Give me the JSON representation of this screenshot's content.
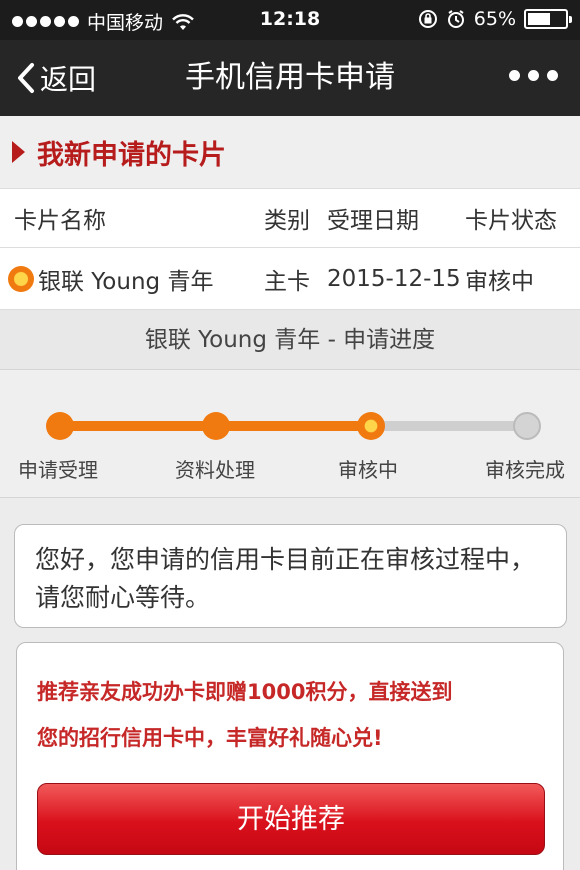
{
  "status_bar": {
    "carrier": "中国移动",
    "time": "12:18",
    "battery": "65%",
    "battery_level": 0.65
  },
  "nav": {
    "back_label": "返回",
    "title": "手机信用卡申请"
  },
  "section": {
    "title": "我新申请的卡片"
  },
  "table": {
    "headers": [
      "卡片名称",
      "类别",
      "受理日期",
      "卡片状态"
    ],
    "rows": [
      {
        "name": "银联 Young 青年",
        "type": "主卡",
        "date": "2015-12-15",
        "status": "审核中"
      }
    ]
  },
  "progress": {
    "title": "银联 Young 青年 - 申请进度",
    "steps": [
      "申请受理",
      "资料处理",
      "审核中",
      "审核完成"
    ],
    "current_step_index": 2,
    "colors": {
      "active": "#f07a10",
      "inactive": "#cfcfcf"
    }
  },
  "message": {
    "text": "您好，您申请的信用卡目前正在审核过程中，请您耐心等待。"
  },
  "promo": {
    "text_line1": "推荐亲友成功办卡即赠1000积分，直接送到",
    "text_line2": "您的招行信用卡中，丰富好礼随心兑!",
    "button_label": "开始推荐"
  },
  "colors": {
    "accent_red": "#b71c1c",
    "button_red": "#d9101c",
    "nav_bg": "#262626"
  }
}
